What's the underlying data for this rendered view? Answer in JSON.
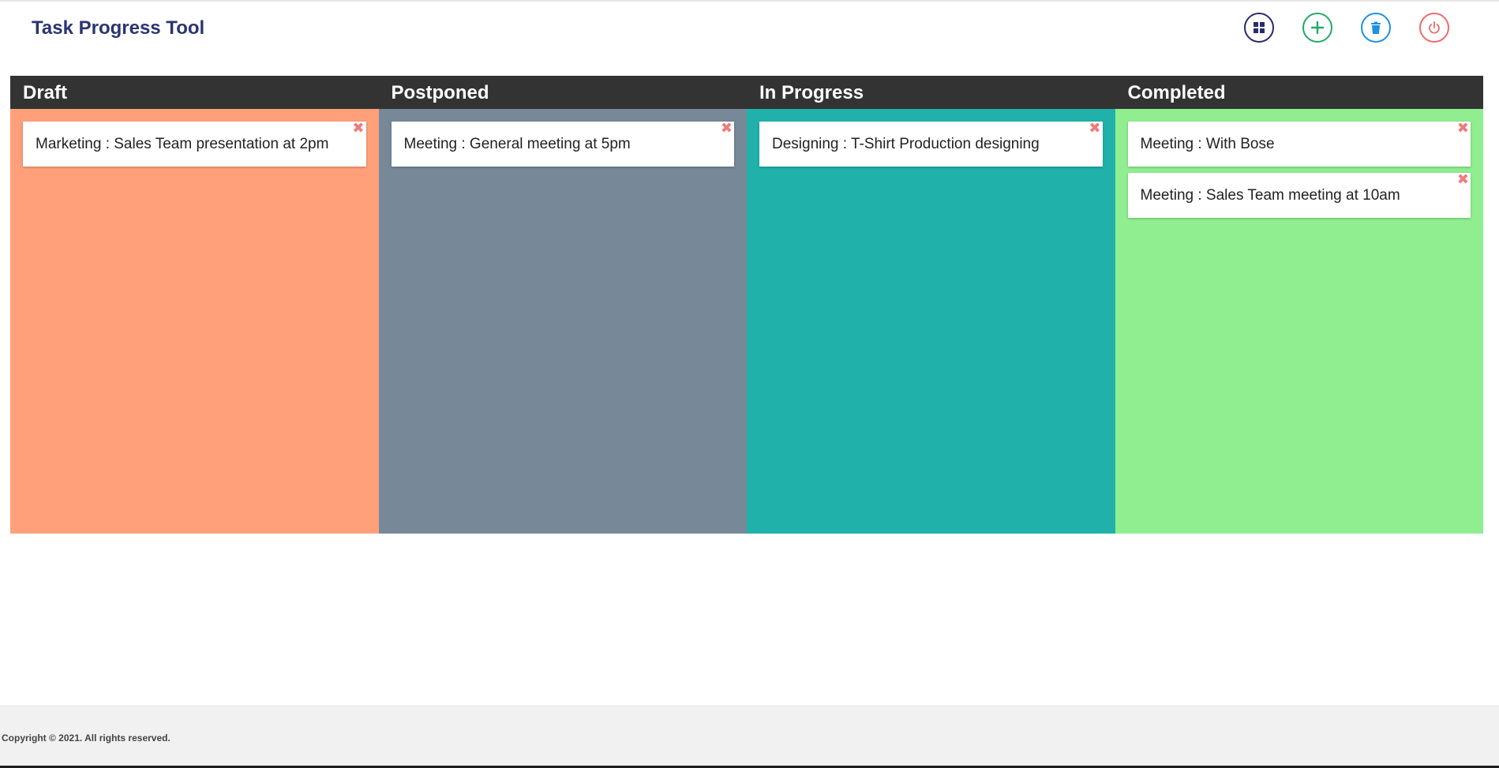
{
  "app": {
    "title": "Task Progress Tool"
  },
  "toolbar": {
    "buttons": [
      {
        "name": "dashboard",
        "icon": "grid-icon",
        "color": "#2a2a6e"
      },
      {
        "name": "add",
        "icon": "plus-icon",
        "color": "#22aa66"
      },
      {
        "name": "delete",
        "icon": "trash-icon",
        "color": "#1f8fe0"
      },
      {
        "name": "logout",
        "icon": "power-icon",
        "color": "#f06a6a"
      }
    ]
  },
  "board": {
    "columns": [
      {
        "title": "Draft",
        "color": "#ffa07a",
        "cards": [
          {
            "text": "Marketing : Sales Team presentation at 2pm"
          }
        ]
      },
      {
        "title": "Postponed",
        "color": "#778899",
        "cards": [
          {
            "text": "Meeting : General meeting at 5pm"
          }
        ]
      },
      {
        "title": "In Progress",
        "color": "#20b2aa",
        "cards": [
          {
            "text": "Designing : T-Shirt Production designing"
          }
        ]
      },
      {
        "title": "Completed",
        "color": "#90ee90",
        "cards": [
          {
            "text": "Meeting : With Bose"
          },
          {
            "text": "Meeting : Sales Team meeting at 10am"
          }
        ]
      }
    ],
    "close_glyph": "✖"
  },
  "footer": {
    "copyright": "Copyright © 2021. All rights reserved."
  }
}
